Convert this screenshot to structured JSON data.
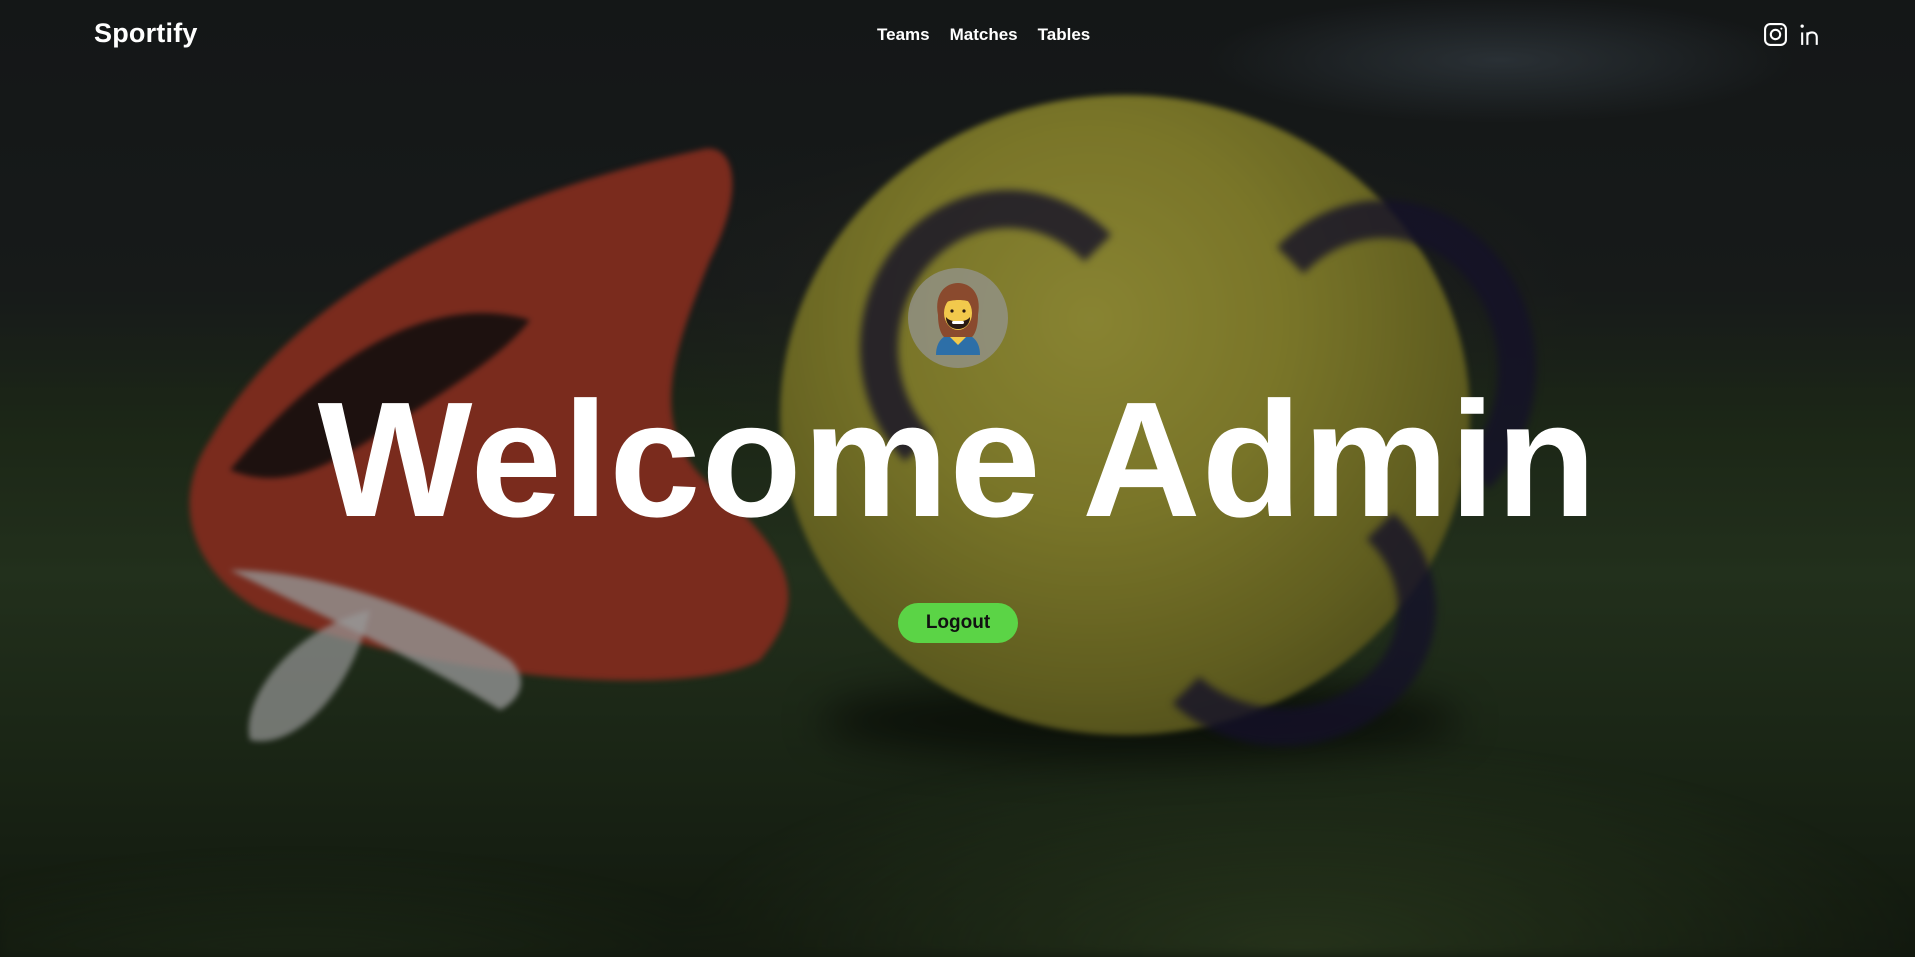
{
  "nav": {
    "brand": "Sportify",
    "links": [
      {
        "label": "Teams"
      },
      {
        "label": "Matches"
      },
      {
        "label": "Tables"
      }
    ],
    "socials": [
      {
        "icon": "instagram-icon"
      },
      {
        "icon": "linkedin-icon"
      }
    ]
  },
  "hero": {
    "avatar_icon": "bearded-man-avatar",
    "title": "Welcome Admin",
    "logout_label": "Logout"
  },
  "colors": {
    "logout_button": "#5bd446",
    "text": "#ffffff"
  }
}
